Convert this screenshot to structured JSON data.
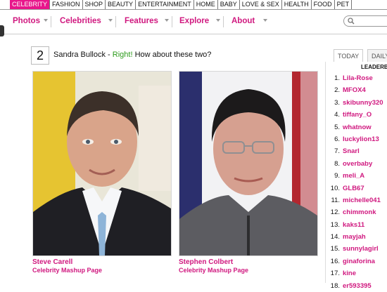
{
  "top_nav": [
    "CELEBRITY",
    "FASHION",
    "SHOP",
    "BEAUTY",
    "ENTERTAINMENT",
    "HOME",
    "BABY",
    "LOVE & SEX",
    "HEALTH",
    "FOOD",
    "PET"
  ],
  "secondary_nav": [
    "Photos",
    "Celebrities",
    "Features",
    "Explore",
    "About"
  ],
  "quiz": {
    "number": "2",
    "previous_answer": "Sandra Bullock - ",
    "result": "Right!",
    "prompt": " How about these two?"
  },
  "photos": [
    {
      "name": "Steve Carell",
      "link": "Celebrity Mashup Page"
    },
    {
      "name": "Stephen Colbert",
      "link": "Celebrity Mashup Page"
    }
  ],
  "leaderboard": {
    "tabs": [
      "TODAY",
      "DAILY"
    ],
    "title": "LEADERBO",
    "entries": [
      {
        "rank": "1.",
        "user": "Lila-Rose"
      },
      {
        "rank": "2.",
        "user": "MFOX4"
      },
      {
        "rank": "3.",
        "user": "skibunny320"
      },
      {
        "rank": "4.",
        "user": "tiffany_O"
      },
      {
        "rank": "5.",
        "user": "whatnow"
      },
      {
        "rank": "6.",
        "user": "luckylion13"
      },
      {
        "rank": "7.",
        "user": "Snarl"
      },
      {
        "rank": "8.",
        "user": "overbaby"
      },
      {
        "rank": "9.",
        "user": "meli_A"
      },
      {
        "rank": "10.",
        "user": "GLB67"
      },
      {
        "rank": "11.",
        "user": "michelle041"
      },
      {
        "rank": "12.",
        "user": "chimmonk"
      },
      {
        "rank": "13.",
        "user": "kaks11"
      },
      {
        "rank": "14.",
        "user": "mayjah"
      },
      {
        "rank": "15.",
        "user": "sunnylagirl"
      },
      {
        "rank": "16.",
        "user": "ginaforina"
      },
      {
        "rank": "17.",
        "user": "kine"
      },
      {
        "rank": "18.",
        "user": "er593395"
      }
    ]
  },
  "colors": {
    "brand": "#e8168b",
    "link": "#d0187f",
    "right": "#2b9a1a"
  },
  "icons": [
    "search-icon",
    "chevron-down-icon"
  ]
}
